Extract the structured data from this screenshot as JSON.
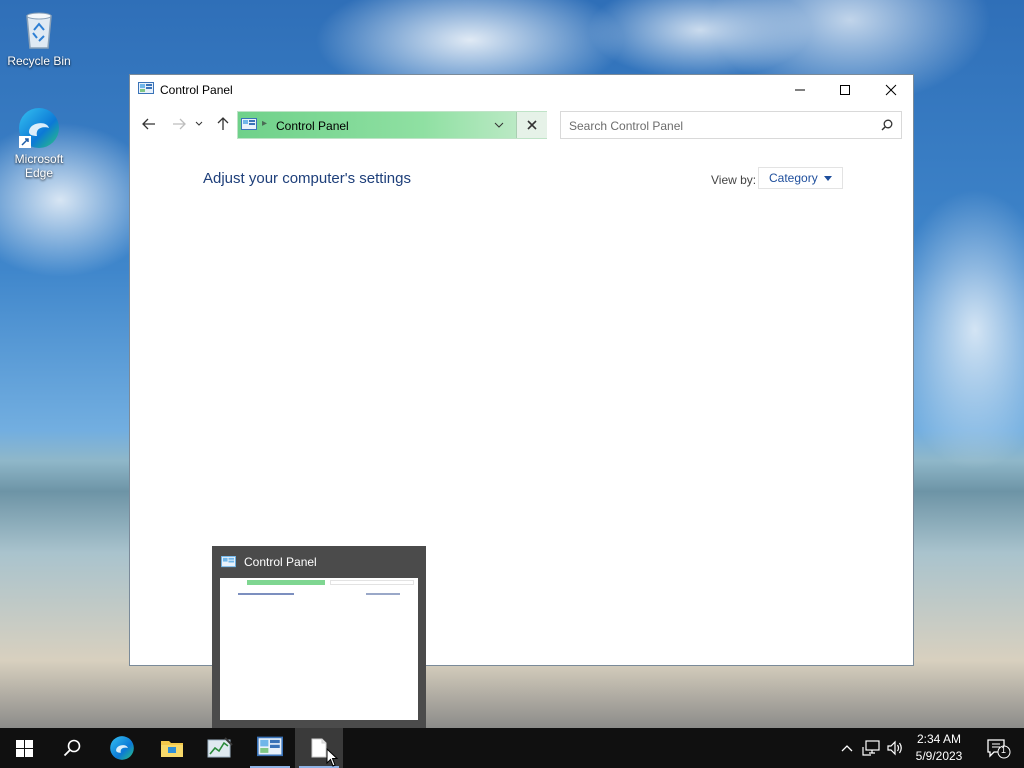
{
  "desktop": {
    "icons": [
      {
        "label": "Recycle Bin",
        "icon": "recycle-bin-icon"
      },
      {
        "label": "Microsoft Edge",
        "icon": "edge-icon"
      }
    ]
  },
  "window": {
    "title": "Control Panel",
    "address": {
      "text": "Control Panel"
    },
    "search": {
      "placeholder": "Search Control Panel"
    },
    "heading": "Adjust your computer's settings",
    "view_by": {
      "label": "View by:",
      "value": "Category"
    }
  },
  "preview": {
    "title": "Control Panel"
  },
  "taskbar": {
    "apps": [
      {
        "name": "Start",
        "icon": "windows-start-icon"
      },
      {
        "name": "Search",
        "icon": "search-icon"
      },
      {
        "name": "Microsoft Edge",
        "icon": "edge-icon"
      },
      {
        "name": "File Explorer",
        "icon": "folder-icon"
      },
      {
        "name": "Task Manager",
        "icon": "task-manager-icon"
      },
      {
        "name": "Control Panel",
        "icon": "control-panel-icon"
      },
      {
        "name": "Notepad",
        "icon": "document-icon"
      }
    ],
    "clock": {
      "time": "2:34 AM",
      "date": "5/9/2023"
    },
    "notifications_count": "1"
  },
  "colors": {
    "accent": "#1e3f7a",
    "address_green": "#6fd18a",
    "taskbar": "#101010"
  }
}
